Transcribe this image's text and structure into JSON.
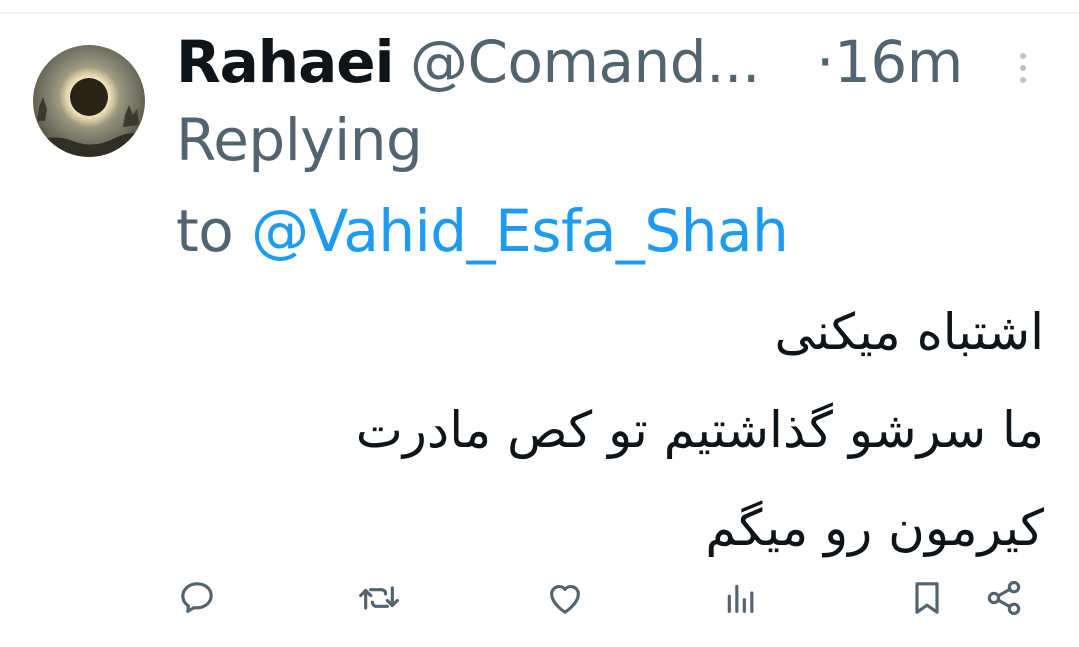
{
  "tweet": {
    "author_name": "Rahaei",
    "author_handle": "@Comand...",
    "separator": "·",
    "time": "16m",
    "replying_label_line1": "Replying",
    "replying_label_to": "to",
    "replying_mention": "@Vahid_Esfa_Shah",
    "text_lines": [
      "اشتباه میکنی",
      "ما سرشو گذاشتیم تو کص مادرت",
      "کیرمون رو میگم"
    ]
  },
  "icons": {
    "more": "more-vertical-icon",
    "reply": "reply-icon",
    "retweet": "retweet-icon",
    "like": "like-icon",
    "views": "views-icon",
    "bookmark": "bookmark-icon",
    "share": "share-icon"
  },
  "colors": {
    "primary_text": "#0f1419",
    "secondary_text": "#536471",
    "mention": "#1d9bf0",
    "divider": "#eff3f4"
  }
}
